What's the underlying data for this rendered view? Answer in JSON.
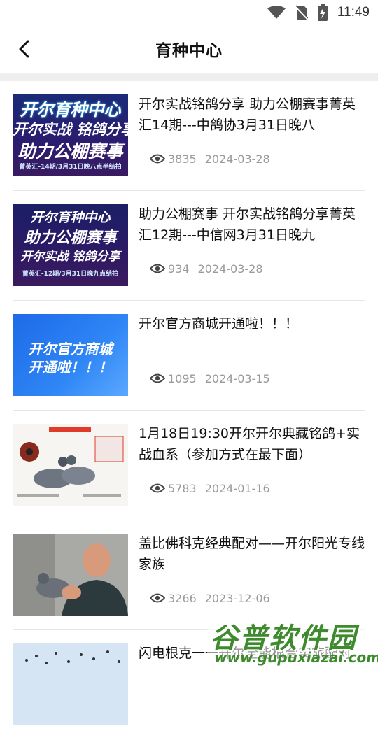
{
  "status": {
    "time": "11:49"
  },
  "nav": {
    "title": "育种中心"
  },
  "thumbs": {
    "t1": {
      "line1": "开尔育种中心",
      "line2": "开尔实战 铭鸽分享",
      "line3": "助力公棚赛事",
      "footer": "菁英汇-14期/3月31日晚八点半结拍"
    },
    "t2": {
      "line1": "开尔育种中心",
      "line2": "助力公棚赛事",
      "line3": "开尔实战 铭鸽分享",
      "footer": "菁英汇-12期/3月31日晚九点结拍"
    },
    "t3": {
      "line1": "开尔官方商城",
      "line2": "开通啦！！！"
    }
  },
  "items": [
    {
      "title": "开尔实战铭鸽分享 助力公棚赛事菁英汇14期---中鸽协3月31日晚八",
      "views": "3835",
      "date": "2024-03-28"
    },
    {
      "title": "助力公棚赛事 开尔实战铭鸽分享菁英汇12期---中信网3月31日晚九",
      "views": "934",
      "date": "2024-03-28"
    },
    {
      "title": "开尔官方商城开通啦！！！",
      "views": "1095",
      "date": "2024-03-15"
    },
    {
      "title": "1月18日19:30开尔开尔典藏铭鸽+实战血系（参加方式在最下面）",
      "views": "5783",
      "date": "2024-01-16"
    },
    {
      "title": "盖比佛科克经典配对——开尔阳光专线家族",
      "views": "3266",
      "date": "2023-12-06"
    },
    {
      "title": "闪电根克一一开尔全能根合实旅配对",
      "views": "",
      "date": ""
    }
  ],
  "watermark": {
    "brand": "谷普软件园",
    "url": "www.gupuxiazai.com"
  }
}
